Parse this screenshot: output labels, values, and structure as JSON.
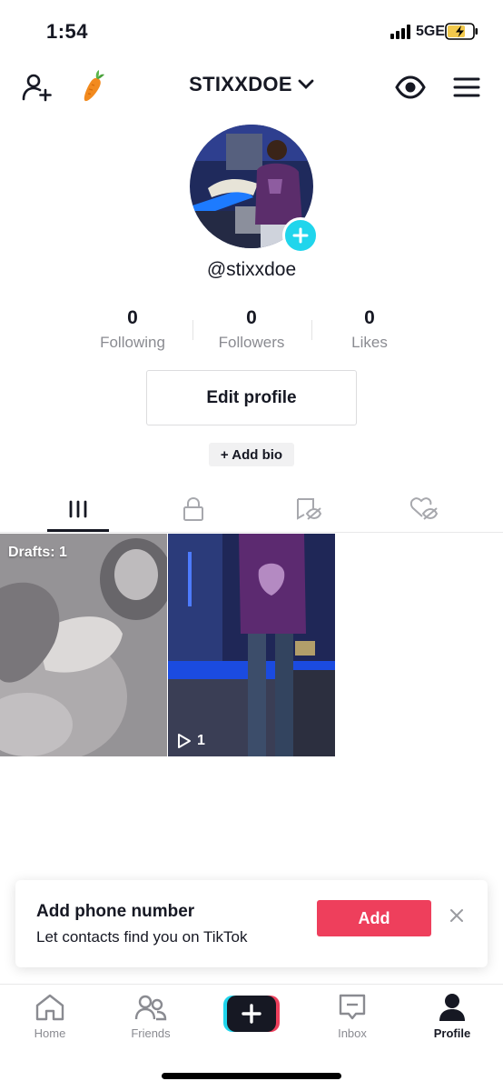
{
  "status_bar": {
    "time": "1:54",
    "network": "5GE"
  },
  "header": {
    "username": "STIXXDOE"
  },
  "profile": {
    "handle": "@stixxdoe",
    "stats": [
      {
        "value": "0",
        "label": "Following"
      },
      {
        "value": "0",
        "label": "Followers"
      },
      {
        "value": "0",
        "label": "Likes"
      }
    ],
    "edit_label": "Edit profile",
    "bio_label": "+ Add bio"
  },
  "grid": {
    "draft_label": "Drafts: 1",
    "video_views": "1"
  },
  "prompt": {
    "title": "Add phone number",
    "subtitle": "Let contacts find you on TikTok",
    "add_label": "Add"
  },
  "nav": {
    "home": "Home",
    "friends": "Friends",
    "inbox": "Inbox",
    "profile": "Profile"
  },
  "colors": {
    "accent": "#ee3f5c",
    "cyan": "#20d5ec",
    "text": "#161823",
    "muted": "#8a8b91"
  }
}
